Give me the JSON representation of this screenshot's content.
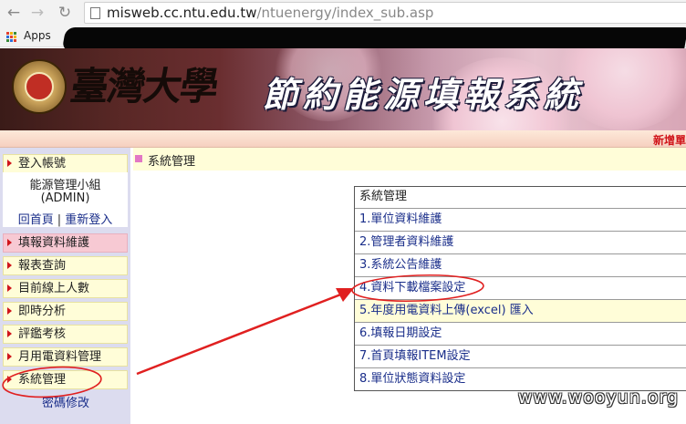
{
  "browser": {
    "url_host": "misweb.cc.ntu.edu.tw",
    "url_path": "/ntuenergy/index_sub.asp",
    "bookmarks": {
      "apps_label": "Apps"
    }
  },
  "banner": {
    "university_calligraphy": "臺灣大學",
    "system_title": "節約能源填報系統",
    "status_label": "新增單"
  },
  "sidebar": {
    "login_label": "登入帳號",
    "user_group": "能源管理小組",
    "user_role": "(ADMIN)",
    "home_link": "回首頁",
    "relogin_link": "重新登入",
    "separator": "|",
    "items": [
      {
        "label": "填報資料維護",
        "active": true
      },
      {
        "label": "報表查詢",
        "active": false
      },
      {
        "label": "目前線上人數",
        "active": false
      },
      {
        "label": "即時分析",
        "active": false
      },
      {
        "label": "評鑑考核",
        "active": false
      },
      {
        "label": "月用電資料管理",
        "active": false
      },
      {
        "label": "系統管理",
        "active": false
      }
    ],
    "password_link": "密碼修改"
  },
  "main": {
    "breadcrumb": "系統管理",
    "table_header": "系統管理",
    "menu_items": [
      {
        "label": "1.單位資料維護"
      },
      {
        "label": "2.管理者資料維護"
      },
      {
        "label": "3.系統公告維護"
      },
      {
        "label": "4.資料下載檔案設定"
      },
      {
        "label": "5.年度用電資料上傳(excel) 匯入"
      },
      {
        "label": "6.填報日期設定"
      },
      {
        "label": "7.首頁填報ITEM設定"
      },
      {
        "label": "8.單位狀態資料設定"
      }
    ]
  },
  "colors": {
    "link": "#1a2e8a",
    "accent_red": "#d0141a",
    "sidebar_bg": "#dcdcef",
    "item_bg": "#fffdd8",
    "active_bg": "#f7c9d3",
    "annotation": "#e02020"
  },
  "watermark": "www.wooyun.org"
}
